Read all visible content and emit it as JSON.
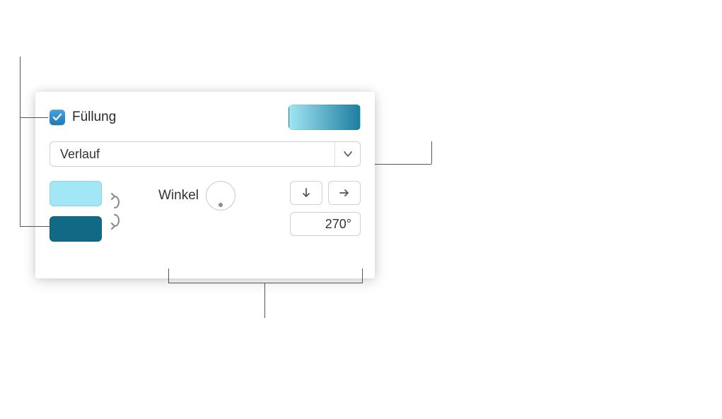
{
  "fill": {
    "checkbox_checked": true,
    "label": "Füllung",
    "type_select": "Verlauf",
    "preview_gradient": {
      "start": "#a0e5f2",
      "end": "#1d7ea0"
    },
    "stops": {
      "color1": "#a1e7f6",
      "color2": "#106a86"
    },
    "angle": {
      "label": "Winkel",
      "value": "270°"
    },
    "direction_buttons": {
      "vertical_icon": "arrow-down",
      "horizontal_icon": "arrow-right"
    }
  }
}
